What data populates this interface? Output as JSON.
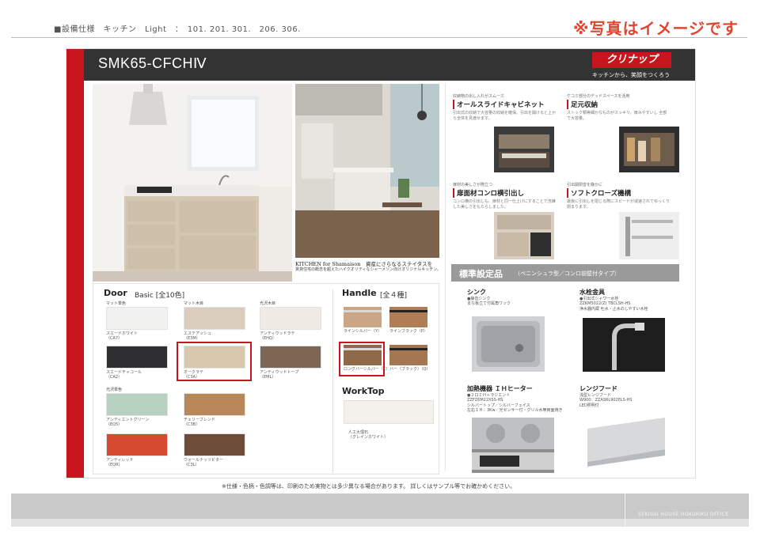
{
  "header": {
    "spec_line": "■設備仕様　キッチン　Light　：　101. 201. 301.　206. 306.",
    "image_note": "※写真はイメージです"
  },
  "title_bar": {
    "model": "SMK65-CFCHⅣ",
    "brand_logo": "クリナップ",
    "brand_tagline": "キッチンから、笑顔をつくろう"
  },
  "photo_caption": {
    "title": "KITCHEN for Shamaison　資産にさらなるステイタスを",
    "sub": "賃貸住宅の概念を超えたハイクオリティなシャーメゾン向けオリジナルキッチン。"
  },
  "features": [
    {
      "tag": "収納物の出し入れがスムーズ",
      "title": "オールスライドキャビネット",
      "desc": "引出式の収納で大容量の収納を確保。引出を開けると上から全体を見渡せます。"
    },
    {
      "tag": "ケコミ部分のデッドスペースを活用",
      "title": "足元収納",
      "desc": "ストック類等細かなものがスッキリ。扉みやすいし 全部で大容量。"
    },
    {
      "tag": "扉材の美しさが際立つ",
      "title": "扉面材コンロ横引出し",
      "desc": "コンロ横の引出しも、扉材と同一仕上げにすることで洗練した美しさをもたらしました。"
    },
    {
      "tag": "引出開閉音を静かに",
      "title": "ソフトクローズ機構",
      "desc": "最後に引出しを閉じる際にスピードが減速されてゆっくり閉まります。"
    }
  ],
  "standard": {
    "title": "標準設定品",
    "subtitle": "（ペニンシュラ型／コンロ前壁付タイプ）",
    "items": [
      {
        "name": "シンク",
        "spec": "●静音シンク\nまな板立て付属角ワック"
      },
      {
        "name": "水栓金具",
        "spec": "●引出式シャワー水栓\nZZKM5022(Z) TBCLSH-HS\n浄水器内蔵 吐水・止水のしやすい水栓"
      },
      {
        "name": "加熱機器 ＩＨヒーター",
        "spec": "●２口ＩＨ＋ラジエント\nZZFZ6M22XSS-HS\nシルバートップ／シルバーフェイス\n左右ＩＨ：3Kw／光センサー付・グリル水無両面焼き"
      },
      {
        "name": "レンジフード",
        "spec": "浅型レンジフード\nW900：ZZASRL902ELS-HS\nLED照明付"
      }
    ]
  },
  "door": {
    "heading": "Door",
    "heading_sub": "Basic [全10色]",
    "groups": [
      "マット単色",
      "マット木目",
      "光沢木目",
      "光沢単色"
    ],
    "swatches": [
      {
        "label": "スエードホワイト\n（CA7）",
        "color": "#f1f1ef"
      },
      {
        "label": "エステアッシュ\n（E3M）",
        "color": "#d9cdbd"
      },
      {
        "label": "アンティウッドラテ\n（EHQ）",
        "color": "#efeae2"
      },
      {
        "label": "スエードチャコール\n（CA2）",
        "color": "#2f2f31"
      },
      {
        "label": "オークラテ\n（C3A）",
        "color": "#d8c6ad"
      },
      {
        "label": "アンティウッドトープ\n（EML）",
        "color": "#7d6654"
      },
      {
        "label": "アンティエントグリーン\n（EQ5）",
        "color": "#b7d2c1"
      },
      {
        "label": "チェリーブレンド\n（C3B）",
        "color": "#b88858"
      },
      {
        "label": "アンティレッド\n（EQR）",
        "color": "#d54a30"
      },
      {
        "label": "ウォールナッツビター\n（C3L）",
        "color": "#6d4d39"
      }
    ]
  },
  "handle": {
    "heading": "Handle",
    "heading_sub": "[全４種]",
    "items": [
      {
        "label": "ラインシルバー（Y）",
        "color": "#caa685"
      },
      {
        "label": "ラインブラック（P）",
        "color": "#b07d54"
      },
      {
        "label": "ロングバーシルバー（C）",
        "color": "#8e6a48"
      },
      {
        "label": "バー（ブラック）（Q）",
        "color": "#a57751"
      }
    ]
  },
  "worktop": {
    "heading": "WorkTop",
    "items": [
      {
        "label": "人工大理石\n（グレインホワイト）",
        "color": "#f4f1ec"
      }
    ]
  },
  "footer": {
    "note": "※仕様・色柄・色調等は、印刷のため実物とは多少異なる場合があります。 詳しくはサンプル等でお確かめください。",
    "company": "SEKISUI HOUSE HOKURIKU OFFICE"
  }
}
